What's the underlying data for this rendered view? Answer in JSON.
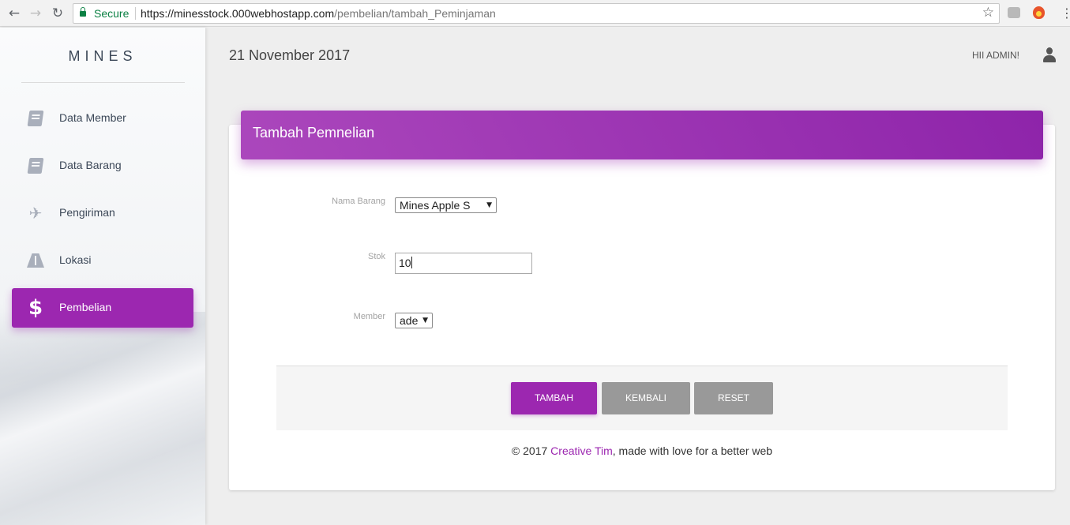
{
  "browser": {
    "secure_label": "Secure",
    "url_host": "https://minesstock.000webhostapp.com",
    "url_path": "/pembelian/tambah_Peminjaman"
  },
  "sidebar": {
    "logo": "MINES",
    "items": [
      {
        "label": "Data Member",
        "icon": "book-icon"
      },
      {
        "label": "Data Barang",
        "icon": "book-icon"
      },
      {
        "label": "Pengiriman",
        "icon": "airplane-icon"
      },
      {
        "label": "Lokasi",
        "icon": "road-icon"
      },
      {
        "label": "Pembelian",
        "icon": "dollar-icon",
        "active": true
      }
    ]
  },
  "header": {
    "date": "21 November 2017",
    "greeting": "HII ADMIN!"
  },
  "form": {
    "title": "Tambah Pemnelian",
    "fields": {
      "nama_barang": {
        "label": "Nama Barang",
        "value": "Mines Apple S"
      },
      "stok": {
        "label": "Stok",
        "value": "10"
      },
      "member": {
        "label": "Member",
        "value": "ade"
      }
    },
    "buttons": {
      "tambah": "TAMBAH",
      "kembali": "KEMBALI",
      "reset": "RESET"
    }
  },
  "footer": {
    "prefix": "© 2017 ",
    "link": "Creative Tim",
    "suffix": ", made with love for a better web"
  },
  "colors": {
    "accent": "#9c27b0",
    "secondary_button": "#999999"
  }
}
